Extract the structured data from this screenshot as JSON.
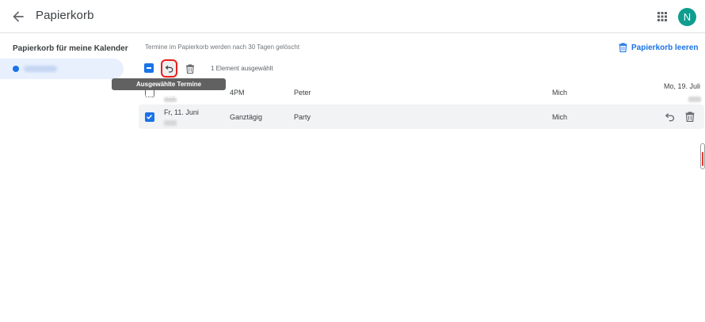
{
  "header": {
    "title": "Papierkorb",
    "avatar_initial": "N",
    "back_icon": "arrow-left-icon",
    "apps_icon": "apps-grid-icon",
    "avatar_color": "#0f9d8f"
  },
  "sidebar": {
    "title": "Papierkorb für meine Kalender",
    "calendar_color": "#1a73e8"
  },
  "main": {
    "notice": "Termine im Papierkorb werden nach 30 Tagen gelöscht",
    "empty_trash_label": "Papierkorb leeren",
    "accent_color": "#1a73e8"
  },
  "toolbar": {
    "selected_count": "1 Element ausgewählt",
    "restore_tooltip": "Ausgewählte Termine wiederherstellen",
    "highlight_color": "#e8201d"
  },
  "rows": [
    {
      "date": "Fr, 11. Juni",
      "time": "4PM",
      "title": "Peter",
      "organizer": "Mich",
      "deleted_date": "Mo, 19. Juli",
      "checked": false
    },
    {
      "date": "Fr, 11. Juni",
      "time": "Ganztägig",
      "title": "Party",
      "organizer": "Mich",
      "deleted_date": "",
      "checked": true
    }
  ]
}
